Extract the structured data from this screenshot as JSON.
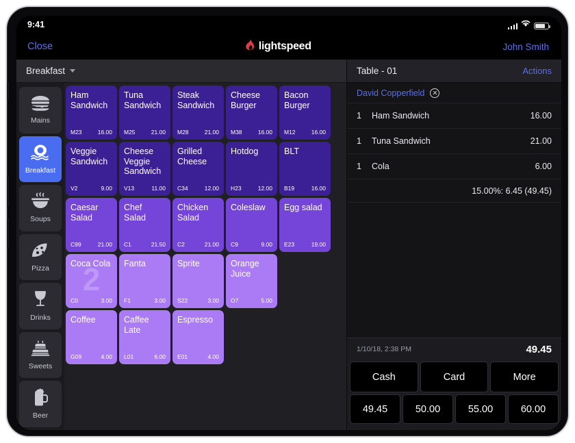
{
  "status_bar": {
    "time": "9:41"
  },
  "topbar": {
    "close_label": "Close",
    "brand_name": "lightspeed",
    "brand_color": "#e03b4a",
    "user_name": "John Smith"
  },
  "menu_bar": {
    "selected_menu": "Breakfast"
  },
  "sidebar": {
    "items": [
      {
        "label": "Mains",
        "icon": "burger-icon",
        "active": false
      },
      {
        "label": "Breakfast",
        "icon": "egg-icon",
        "active": true
      },
      {
        "label": "Soups",
        "icon": "soup-bowl-icon",
        "active": false
      },
      {
        "label": "Pizza",
        "icon": "pizza-icon",
        "active": false
      },
      {
        "label": "Drinks",
        "icon": "wine-glass-icon",
        "active": false
      },
      {
        "label": "Sweets",
        "icon": "cake-icon",
        "active": false
      },
      {
        "label": "Beer",
        "icon": "beer-mug-icon",
        "active": false
      }
    ],
    "active_color": "#4a6cf0"
  },
  "grid": {
    "colors": {
      "dark": "#3b1f94",
      "mid": "#7544d8",
      "light": "#ab7bf5"
    },
    "rows": [
      {
        "shade": "dark",
        "tiles": [
          {
            "name": "Ham Sandwich",
            "code": "M23",
            "price": "16.00"
          },
          {
            "name": "Tuna Sandwich",
            "code": "M25",
            "price": "21.00"
          },
          {
            "name": "Steak Sandwich",
            "code": "M28",
            "price": "21.00"
          },
          {
            "name": "Cheese Burger",
            "code": "M38",
            "price": "16.00"
          },
          {
            "name": "Bacon Burger",
            "code": "M12",
            "price": "16.00"
          }
        ]
      },
      {
        "shade": "dark",
        "tiles": [
          {
            "name": "Veggie Sandwich",
            "code": "V2",
            "price": "9.00"
          },
          {
            "name": "Cheese Veggie Sandwich",
            "code": "V13",
            "price": "11.00"
          },
          {
            "name": "Grilled Cheese",
            "code": "C34",
            "price": "12.00"
          },
          {
            "name": "Hotdog",
            "code": "H23",
            "price": "12.00"
          },
          {
            "name": "BLT",
            "code": "B19",
            "price": "16.00"
          }
        ]
      },
      {
        "shade": "mid",
        "tiles": [
          {
            "name": "Caesar Salad",
            "code": "C99",
            "price": "21.00"
          },
          {
            "name": "Chef Salad",
            "code": "C1",
            "price": "21.50"
          },
          {
            "name": "Chicken Salad",
            "code": "C2",
            "price": "21.00"
          },
          {
            "name": "Coleslaw",
            "code": "C9",
            "price": "9.00"
          },
          {
            "name": "Egg salad",
            "code": "E23",
            "price": "19.00"
          }
        ]
      },
      {
        "shade": "light",
        "tiles": [
          {
            "name": "Coca Cola",
            "code": "C0",
            "price": "3.00",
            "qty": "2"
          },
          {
            "name": "Fanta",
            "code": "F1",
            "price": "3.00"
          },
          {
            "name": "Sprite",
            "code": "S22",
            "price": "3.00"
          },
          {
            "name": "Orange Juice",
            "code": "O7",
            "price": "5.00"
          }
        ]
      },
      {
        "shade": "light",
        "tiles": [
          {
            "name": "Coffee",
            "code": "G09",
            "price": "4.00"
          },
          {
            "name": "Caffee Late",
            "code": "L01",
            "price": "6.00"
          },
          {
            "name": "Espresso",
            "code": "E01",
            "price": "4.00"
          }
        ]
      }
    ]
  },
  "order": {
    "title": "Table - 01",
    "actions_label": "Actions",
    "customer": "David Copperfield",
    "items": [
      {
        "qty": "1",
        "name": "Ham Sandwich",
        "price": "16.00"
      },
      {
        "qty": "1",
        "name": "Tuna Sandwich",
        "price": "21.00"
      },
      {
        "qty": "1",
        "name": "Cola",
        "price": "6.00"
      }
    ],
    "tip_line": "15.00%: 6.45 (49.45)",
    "timestamp": "1/10/18, 2:38 PM",
    "total": "49.45",
    "payment_buttons": [
      "Cash",
      "Card",
      "More"
    ],
    "quick_amounts": [
      "49.45",
      "50.00",
      "55.00",
      "60.00"
    ]
  }
}
